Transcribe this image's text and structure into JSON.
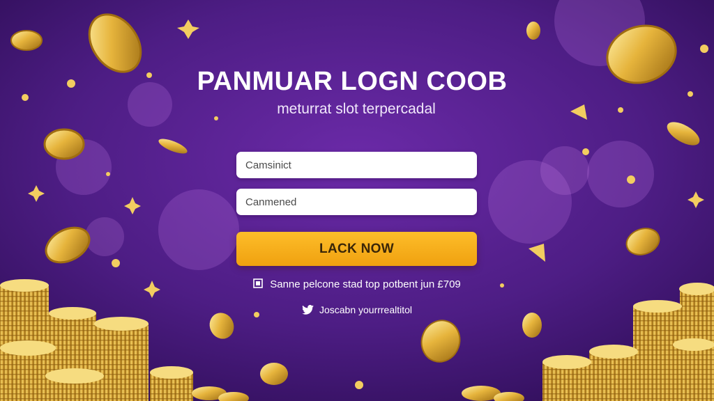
{
  "header": {
    "title": "PANMUAR LOGN COOB",
    "subtitle": "meturrat slot terpercadal"
  },
  "form": {
    "field1_placeholder": "Camsinict",
    "field2_placeholder": "Canmened",
    "submit_label": "LACK NOW"
  },
  "footer": {
    "info_text": "Sanne pelcone stad top potbent jun £709",
    "info_icon": "notice-icon",
    "social_text": "Joscabn yourrrealtitol",
    "social_icon": "twitter-icon"
  },
  "colors": {
    "background": "#4d1d84",
    "button": "#f8ae1b",
    "coin": "#e3b43a"
  }
}
